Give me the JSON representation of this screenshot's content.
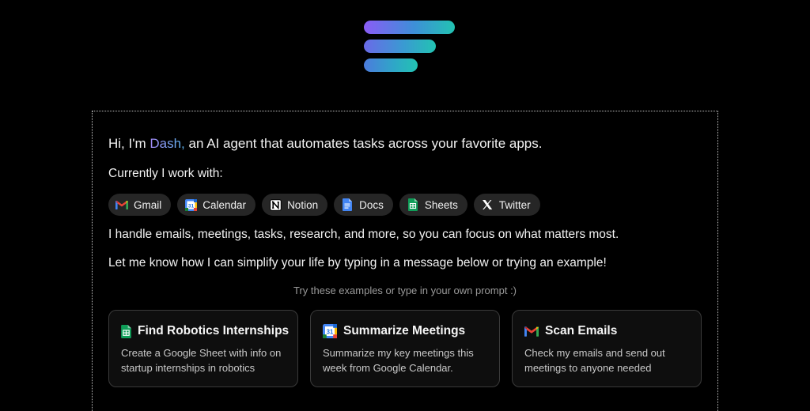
{
  "intro": {
    "prefix": "Hi, I'm ",
    "name": "Dash,",
    "suffix": " an AI agent that automates tasks across your favorite apps."
  },
  "works_with_label": "Currently I work with:",
  "apps": [
    {
      "label": "Gmail",
      "icon": "gmail-icon"
    },
    {
      "label": "Calendar",
      "icon": "calendar-icon"
    },
    {
      "label": "Notion",
      "icon": "notion-icon"
    },
    {
      "label": "Docs",
      "icon": "docs-icon"
    },
    {
      "label": "Sheets",
      "icon": "sheets-icon"
    },
    {
      "label": "Twitter",
      "icon": "twitter-x-icon"
    }
  ],
  "line1": "I handle emails, meetings, tasks, research, and more, so you can focus on what matters most.",
  "line2": "Let me know how I can simplify your life by typing in a message below or trying an example!",
  "hint": "Try these examples or type in your own prompt :)",
  "examples": [
    {
      "title": "Find Robotics Internships",
      "desc": "Create a Google Sheet with info on startup internships in robotics",
      "icon": "sheets-icon"
    },
    {
      "title": "Summarize Meetings",
      "desc": "Summarize my key meetings this week from Google Calendar.",
      "icon": "calendar-icon"
    },
    {
      "title": "Scan Emails",
      "desc": "Check my emails and send out meetings to anyone needed",
      "icon": "gmail-icon"
    }
  ],
  "colors": {
    "background": "#000000",
    "chip": "#262626",
    "card_border": "#3a3a3a",
    "dash_gradient_start": "#a78bfa",
    "dash_gradient_end": "#5ab6f0"
  }
}
